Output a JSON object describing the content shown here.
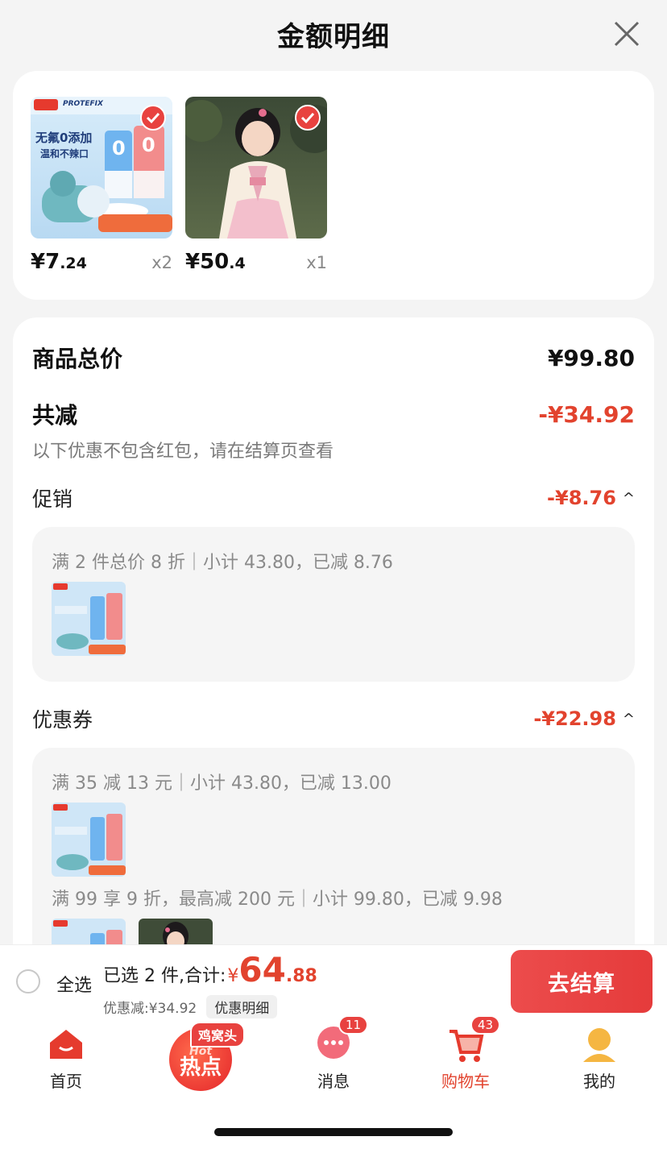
{
  "header": {
    "title": "金额明细"
  },
  "products": [
    {
      "price_int": "¥7",
      "price_dec": ".24",
      "qty": "x2",
      "brand": "PROTEFIX",
      "text": "无氟0添加",
      "text2": "温和不辣口"
    },
    {
      "price_int": "¥50",
      "price_dec": ".4",
      "qty": "x1"
    }
  ],
  "summary": {
    "total_label": "商品总价",
    "total_value": "¥99.80",
    "reduce_label": "共减",
    "reduce_value": "-¥34.92",
    "note": "以下优惠不包含红包，请在结算页查看"
  },
  "promo": {
    "label": "促销",
    "value": "-¥8.76",
    "line": "满 2 件总价 8 折｜小计 43.80，已减 8.76"
  },
  "coupon": {
    "label": "优惠券",
    "value": "-¥22.98",
    "line1": "满 35 减 13 元｜小计 43.80，已减 13.00",
    "line2": "满 99 享 9 折，最高减 200 元｜小计 99.80，已减 9.98"
  },
  "bottom": {
    "select_all": "全选",
    "selected_text": "已选 2 件,合计:",
    "currency": "¥",
    "total_int": "64",
    "total_dec": ".88",
    "discount_text": "优惠减:¥34.92",
    "discount_detail": "优惠明细",
    "checkout": "去结算"
  },
  "tabbar": {
    "home": "首页",
    "hot_tag": "鸡窝头",
    "hot_en": "Hot",
    "hot_cn": "热点",
    "messages": "消息",
    "messages_badge": "11",
    "cart": "购物车",
    "cart_badge": "43",
    "mine": "我的"
  },
  "colors": {
    "accent": "#e2432e",
    "checkout": "#e53b3b"
  }
}
